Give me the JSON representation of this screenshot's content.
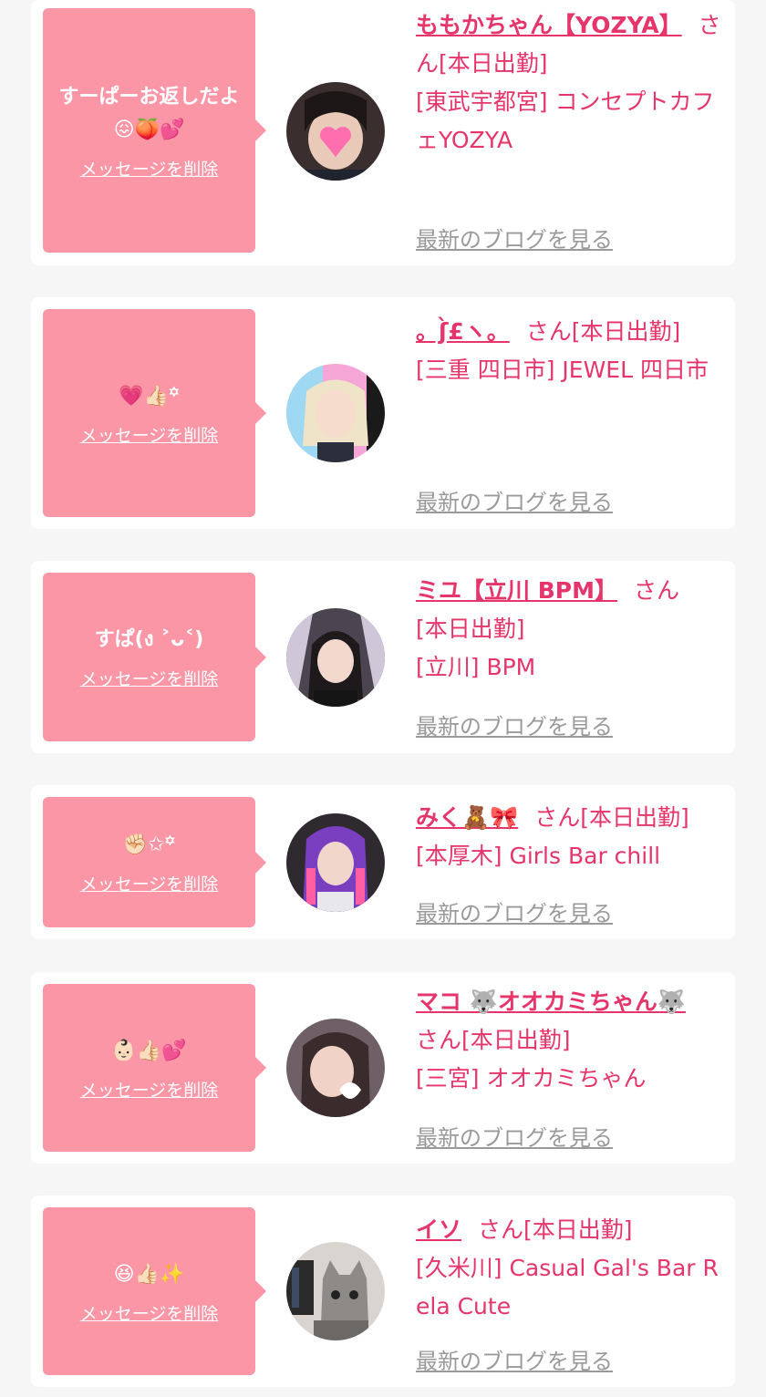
{
  "colors": {
    "background": "#f6f6f6",
    "card": "#ffffff",
    "bubble": "#fb96a6",
    "accent": "#e5356a",
    "blog_link": "#9a9a9a"
  },
  "cards": [
    {
      "message": "すーぱーお返しだよ😖🍑💕",
      "delete_label": "メッセージを削除",
      "name": "ももかちゃん【YOZYA】",
      "honorific": "さん",
      "status": "[本日出勤]",
      "location": "[東武宇都宮] コンセプトカフェYOZYA",
      "blog_label": "最新のブログを見る"
    },
    {
      "message": "💗👍🏻꙳",
      "delete_label": "メッセージを削除",
      "name": "。ʃ̀£ヽ。",
      "honorific": "さん",
      "status": "[本日出勤]",
      "location": "[三重 四日市] JEWEL 四日市",
      "blog_label": "最新のブログを見る"
    },
    {
      "message": "すぱ(ง ˃ᴗ˂)",
      "delete_label": "メッセージを削除",
      "name": "ミユ【立川 BPM】",
      "honorific": "さん",
      "status": "[本日出勤]",
      "location": "[立川] BPM",
      "blog_label": "最新のブログを見る"
    },
    {
      "message": "✊🏻✩꙳",
      "delete_label": "メッセージを削除",
      "name": "みく🧸🎀",
      "honorific": "さん",
      "status": "[本日出勤]",
      "location": "[本厚木] Girls Bar chill",
      "blog_label": "最新のブログを見る"
    },
    {
      "message": "👶🏻👍🏻💕",
      "delete_label": "メッセージを削除",
      "name": "マコ 🐺オオカミちゃん🐺",
      "honorific": "さん",
      "status": "[本日出勤]",
      "location": "[三宮] オオカミちゃん",
      "blog_label": "最新のブログを見る"
    },
    {
      "message": "😆👍🏻✨",
      "delete_label": "メッセージを削除",
      "name": "イソ",
      "honorific": "さん",
      "status": "[本日出勤]",
      "location": "[久米川] Casual Gal's Bar Rela Cute",
      "blog_label": "最新のブログを見る"
    }
  ]
}
